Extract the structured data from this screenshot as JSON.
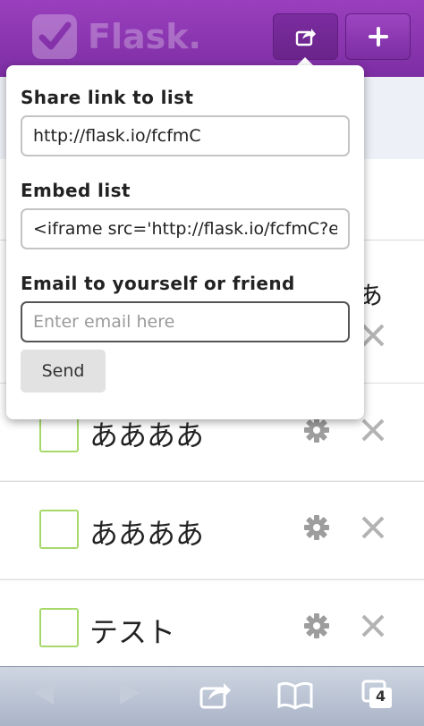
{
  "header": {
    "app_name": "Flask.",
    "share_icon": "share-icon",
    "add_icon": "plus-icon"
  },
  "popover": {
    "share_label": "Share link to list",
    "share_value": "http://flask.io/fcfmC",
    "embed_label": "Embed list",
    "embed_value": "<iframe src='http://flask.io/fcfmC?embed=true'",
    "email_label": "Email to yourself or friend",
    "email_placeholder": "Enter email here",
    "send_label": "Send"
  },
  "list": {
    "partial_text": "あ",
    "rows": [
      {
        "label": "ああああ"
      },
      {
        "label": "ああああ"
      },
      {
        "label": "テスト"
      }
    ]
  },
  "toolbar": {
    "tabs_count": "4"
  },
  "colors": {
    "header": "#8a35b0",
    "checkbox_border": "#a7d96a"
  }
}
